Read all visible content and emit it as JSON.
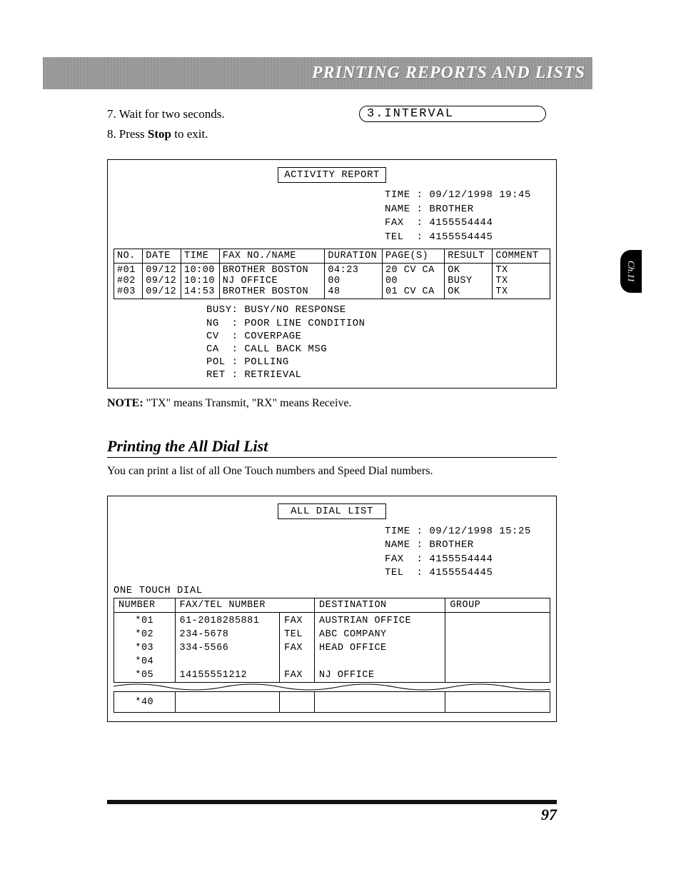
{
  "header_title": "PRINTING REPORTS AND LISTS",
  "chapter_tab": "Ch.11",
  "steps": [
    {
      "num": "7.",
      "text": "Wait for two seconds."
    },
    {
      "num": "8.",
      "pre": "Press ",
      "bold": "Stop",
      "post": " to exit."
    }
  ],
  "lcd": "3.INTERVAL",
  "activity_report": {
    "title": "ACTIVITY REPORT",
    "meta": {
      "time_label": "TIME",
      "time": "09/12/1998 19:45",
      "name_label": "NAME",
      "name": "BROTHER",
      "fax_label": "FAX",
      "fax": "4155554444",
      "tel_label": "TEL",
      "tel": "4155554445"
    },
    "columns": [
      "NO.",
      "DATE",
      "TIME",
      "FAX NO./NAME",
      "DURATION",
      "PAGE(S)",
      "RESULT",
      "COMMENT"
    ],
    "rows": [
      {
        "no": "#01",
        "date": "09/12",
        "time": "10:00",
        "name": "BROTHER BOSTON",
        "dur": "04:23",
        "pages": "20 CV CA",
        "result": "OK",
        "comment": "TX"
      },
      {
        "no": "#02",
        "date": "09/12",
        "time": "10:10",
        "name": "NJ OFFICE",
        "dur": "00",
        "pages": "00",
        "result": "BUSY",
        "comment": "TX"
      },
      {
        "no": "#03",
        "date": "09/12",
        "time": "14:53",
        "name": "BROTHER BOSTON",
        "dur": "48",
        "pages": "01 CV CA",
        "result": "OK",
        "comment": "TX"
      }
    ],
    "legend": "BUSY: BUSY/NO RESPONSE\nNG  : POOR LINE CONDITION\nCV  : COVERPAGE\nCA  : CALL BACK MSG\nPOL : POLLING\nRET : RETRIEVAL"
  },
  "note": {
    "label": "NOTE:",
    "text": " \"TX\" means Transmit, \"RX\" means Receive."
  },
  "section2": {
    "heading": "Printing the All Dial List",
    "desc": "You can print a list of all One Touch numbers and Speed Dial numbers."
  },
  "all_dial": {
    "title": "ALL DIAL LIST",
    "meta": {
      "time_label": "TIME",
      "time": "09/12/1998 15:25",
      "name_label": "NAME",
      "name": "BROTHER",
      "fax_label": "FAX",
      "fax": "4155554444",
      "tel_label": "TEL",
      "tel": "4155554445"
    },
    "one_touch_label": "ONE TOUCH DIAL",
    "columns": [
      "NUMBER",
      "FAX/TEL NUMBER",
      "",
      "DESTINATION",
      "GROUP"
    ],
    "rows": [
      {
        "num": "*01",
        "faxtel": "61-2018285881",
        "type": "FAX",
        "dest": "AUSTRIAN OFFICE",
        "group": ""
      },
      {
        "num": "*02",
        "faxtel": "234-5678",
        "type": "TEL",
        "dest": "ABC COMPANY",
        "group": ""
      },
      {
        "num": "*03",
        "faxtel": "334-5566",
        "type": "FAX",
        "dest": "HEAD OFFICE",
        "group": ""
      },
      {
        "num": "*04",
        "faxtel": "",
        "type": "",
        "dest": "",
        "group": ""
      },
      {
        "num": "*05",
        "faxtel": "14155551212",
        "type": "FAX",
        "dest": "NJ OFFICE",
        "group": ""
      }
    ],
    "last_row": {
      "num": "*40",
      "faxtel": "",
      "type": "",
      "dest": "",
      "group": ""
    }
  },
  "page_number": "97"
}
